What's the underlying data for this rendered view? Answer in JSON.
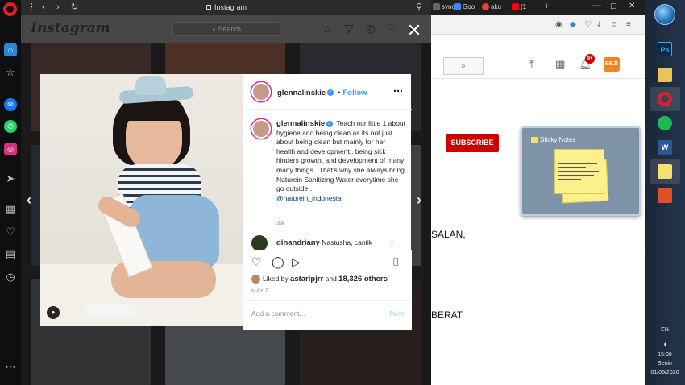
{
  "opera_sidebar": {
    "icons": [
      "opera-logo",
      "home-icon",
      "bookmark-icon",
      "messenger-icon",
      "whatsapp-icon",
      "instagram-icon",
      "send-icon",
      "speed-dial-icon",
      "heart-icon",
      "news-icon",
      "history-icon",
      "more-icon"
    ]
  },
  "ig_window": {
    "title": "Instagram",
    "nav_icons": [
      "home-icon",
      "direct-icon",
      "explore-icon",
      "activity-icon",
      "profile-icon"
    ]
  },
  "ig_header": {
    "logo": "Instagram",
    "search_placeholder": "Search"
  },
  "modal": {
    "username": "glennalinskie",
    "follow_label": "Follow",
    "caption_user": "glennalinskie",
    "caption_text": "Teach our little 1 about hygiene and being clean as its not just about being clean but mainly for her health and development.. being sick hinders growth, and development of many many things.. That’s why she always bring Naturein Sanitizing Water everytime she go outside..",
    "caption_mention": "@naturein_indonesia",
    "time_ago": "3w",
    "comment_user": "dinandriany",
    "comment_text": "Nastusha, cantik",
    "likes_prefix": "Liked by",
    "likes_user": "astaripjrr",
    "likes_mid": "and",
    "likes_count": "18,326 others",
    "date": "MAY 7",
    "add_comment_placeholder": "Add a comment...",
    "post_label": "Post"
  },
  "bg_browser": {
    "tabs": [
      "sync",
      "Goo",
      "aku",
      "(1"
    ],
    "subscribe_label": "SUBSCRIBE",
    "notif_count": "9+",
    "channel_avatar": "BEJ!",
    "text_line_1": "SALAN,",
    "text_line_2": "BERAT"
  },
  "sticky_notes": {
    "title": "Sticky Notes"
  },
  "taskbar": {
    "apps": [
      "Ps",
      "folder",
      "Opera",
      "Spotify",
      "W",
      "notes",
      "PDF"
    ],
    "language": "EN",
    "time": "15:30",
    "day": "Senin",
    "date": "01/06/2020"
  },
  "colors": {
    "instagram_blue": "#3897f0",
    "youtube_red": "#cc0000",
    "opera_red": "#e0202a"
  }
}
